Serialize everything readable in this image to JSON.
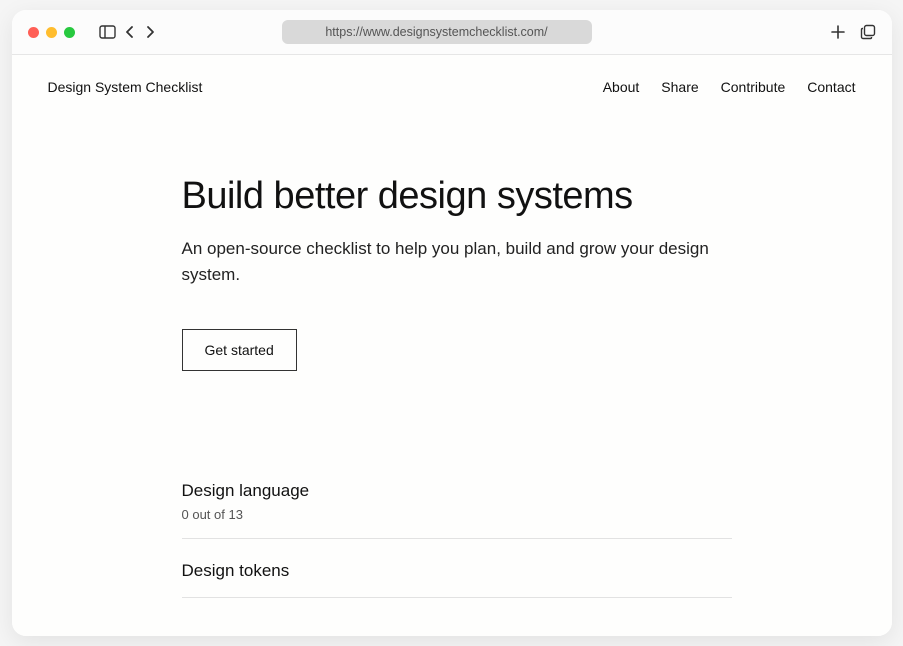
{
  "browser": {
    "url": "https://www.designsystemchecklist.com/"
  },
  "header": {
    "site_title": "Design System Checklist",
    "nav": {
      "about": "About",
      "share": "Share",
      "contribute": "Contribute",
      "contact": "Contact"
    }
  },
  "hero": {
    "title": "Build better design systems",
    "subtitle": "An open-source checklist to help you plan, build and grow your design system.",
    "cta_label": "Get started"
  },
  "sections": {
    "item0": {
      "title": "Design language",
      "progress": "0 out of 13"
    },
    "item1": {
      "title": "Design tokens"
    }
  }
}
